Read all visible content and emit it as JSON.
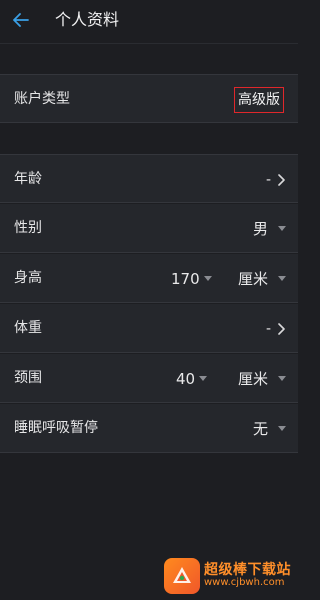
{
  "header": {
    "title": "个人资料",
    "back_icon": "arrow-left-icon"
  },
  "account": {
    "label": "账户类型",
    "value": "高级版"
  },
  "profile": {
    "age": {
      "label": "年龄",
      "value": "-"
    },
    "gender": {
      "label": "性别",
      "value": "男"
    },
    "height": {
      "label": "身高",
      "value": "170",
      "unit": "厘米"
    },
    "weight": {
      "label": "体重",
      "value": "-"
    },
    "neck": {
      "label": "颈围",
      "value": "40",
      "unit": "厘米"
    },
    "sleep_apnea": {
      "label": "睡眠呼吸暂停",
      "value": "无"
    }
  },
  "watermark": {
    "name": "超级棒下载站",
    "url": "www.cjbwh.com"
  },
  "colors": {
    "accent_back": "#3aa0e6",
    "badge_border": "#e0272b",
    "watermark": "#ff8f2a"
  }
}
